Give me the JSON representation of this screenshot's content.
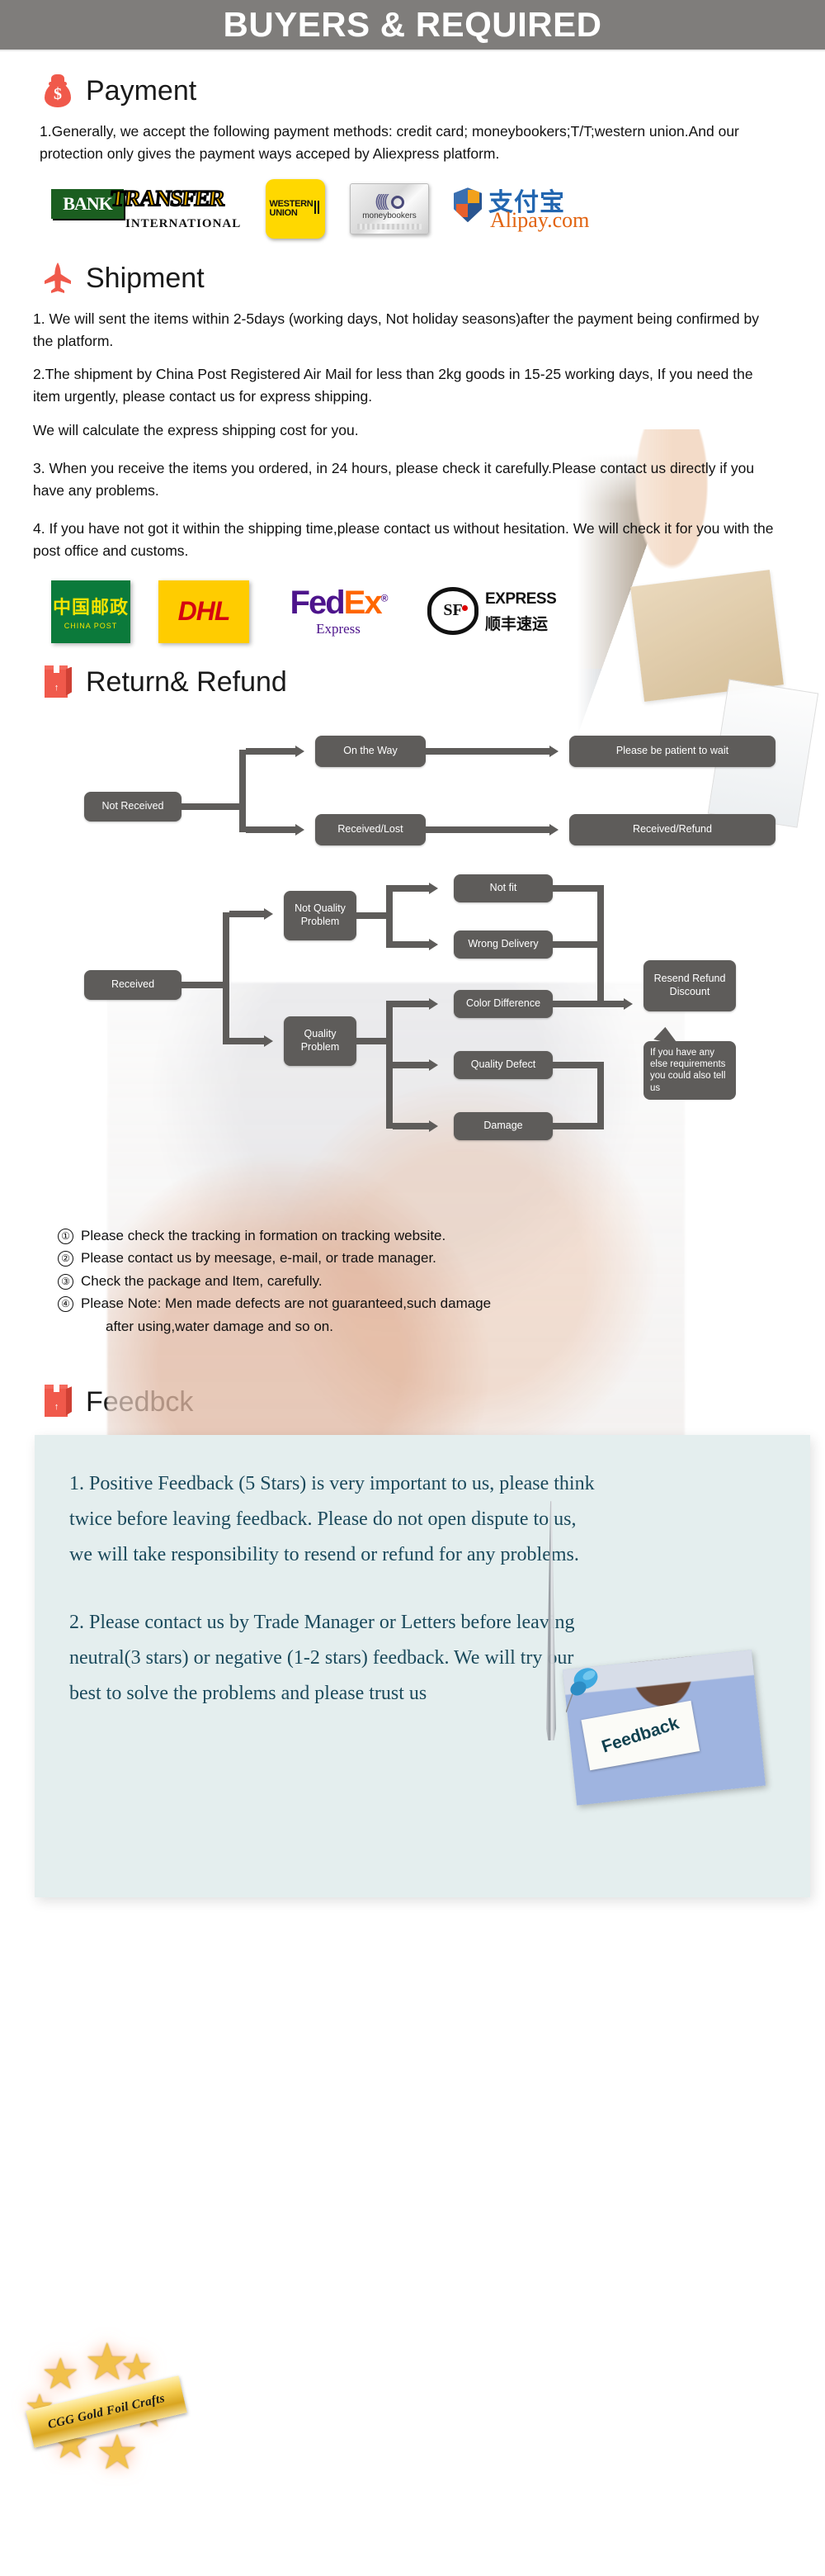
{
  "banner": {
    "title": "BUYERS & REQUIRED"
  },
  "payment": {
    "icon": "money-bag-icon",
    "heading": "Payment",
    "paragraph": "1.Generally, we accept the following payment methods: credit card; moneybookers;T/T;western union.And our protection only gives the payment ways acceped by Aliexpress platform.",
    "logos": [
      {
        "name": "bank-transfer-logo",
        "primary": "BANK",
        "secondary": "TRANSFER",
        "sub": "INTERNATIONAL"
      },
      {
        "name": "western-union-logo",
        "line1": "WESTERN",
        "line2": "UNION"
      },
      {
        "name": "moneybookers-logo",
        "label": "moneybookers"
      },
      {
        "name": "alipay-logo",
        "cn": "支付宝",
        "en": "Alipay.com"
      }
    ]
  },
  "shipment": {
    "icon": "airplane-icon",
    "heading": "Shipment",
    "paragraphs": [
      "1. We will sent the items within 2-5days (working days, Not holiday seasons)after the payment being confirmed by the platform.",
      "2.The shipment by China Post Registered Air Mail for less than  2kg goods in 15-25 working days, If  you need the item urgently, please contact us for express shipping.",
      "We will calculate the express shipping cost for you.",
      "3. When you receive the items you ordered, in 24 hours, please check  it carefully.Please contact us directly if you have any problems.",
      "4. If you have not got it within the shipping time,please contact us without hesitation. We will check it for you with the post office and customs."
    ],
    "logos": [
      {
        "name": "china-post-logo",
        "cn": "中国邮政",
        "en": "CHINA POST"
      },
      {
        "name": "dhl-logo",
        "label": "DHL"
      },
      {
        "name": "fedex-logo",
        "part1": "Fed",
        "part2": "Ex",
        "sub": "Express"
      },
      {
        "name": "sf-express-logo",
        "mark": "SF",
        "en": "EXPRESS",
        "cn": "顺丰速运"
      }
    ]
  },
  "returns": {
    "icon": "package-icon",
    "heading": "Return& Refund",
    "flow": {
      "not_received": "Not Received",
      "on_the_way": "On the Way",
      "please_wait": "Please be patient to wait",
      "received_lost": "Received/Lost",
      "received_refund": "Received/Refund",
      "received": "Received",
      "not_quality_problem": "Not Quality Problem",
      "quality_problem": "Quality Problem",
      "not_fit": "Not fit",
      "wrong_delivery": "Wrong Delivery",
      "color_difference": "Color Difference",
      "quality_defect": "Quality Defect",
      "damage": "Damage",
      "resend_refund_discount": "Resend Refund Discount",
      "callout": "If you have any else requirements you could also tell us"
    },
    "notes": [
      {
        "marker": "①",
        "text": "Please check the tracking in formation on tracking website."
      },
      {
        "marker": "②",
        "text": "Please contact us by meesage, e-mail, or trade manager."
      },
      {
        "marker": "③",
        "text": "Check the package and Item, carefully."
      },
      {
        "marker": "④",
        "text": "Please Note: Men made defects  are not guaranteed,such damage"
      }
    ],
    "notes_continuation": "after using,water damage and so on."
  },
  "feedback": {
    "icon": "package-icon",
    "heading": "Feedbck",
    "photo_card_label": "Feedback",
    "paragraphs": [
      "1. Positive Feedback (5 Stars) is very important to us, please think twice before leaving feedback. Please do not open dispute to us,   we will take responsibility to resend or refund for any problems.",
      "2. Please contact us by Trade Manager or Letters before leaving neutral(3 stars) or negative (1-2 stars) feedback. We will try our best to solve the problems and please trust us"
    ]
  },
  "seal": {
    "label": "CGG Gold Foil Crafts"
  },
  "colors": {
    "banner_bg": "#7f7d7b",
    "accent_red": "#f0594b",
    "flow_node": "#5e5c5a",
    "feedback_panel": "#e4eeee",
    "feedback_text": "#1b4a5c",
    "gold": "#f2c14b"
  }
}
